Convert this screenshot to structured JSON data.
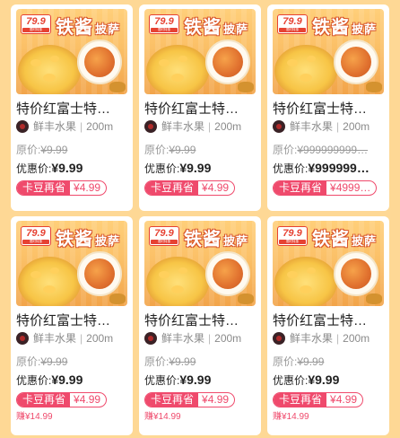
{
  "banner": {
    "price": "79.9",
    "tag_sub": "限时特惠",
    "headline_big": "铁酱",
    "headline_small": "披萨"
  },
  "row1": [
    {
      "title": "特价红富士特…",
      "shop": "鲜丰水果",
      "distance": "200m",
      "orig_label": "原价:",
      "orig_price": "¥9.99",
      "disc_label": "优惠价:",
      "disc_price": "¥9.99",
      "coupon_label": "卡豆再省",
      "coupon_amount": "¥4.99"
    },
    {
      "title": "特价红富士特…",
      "shop": "鲜丰水果",
      "distance": "200m",
      "orig_label": "原价:",
      "orig_price": "¥9.99",
      "disc_label": "优惠价:",
      "disc_price": "¥9.99",
      "coupon_label": "卡豆再省",
      "coupon_amount": "¥4.99"
    },
    {
      "title": "特价红富士特…",
      "shop": "鲜丰水果",
      "distance": "200m",
      "orig_label": "原价:",
      "orig_price": "¥999999999…",
      "disc_label": "优惠价:",
      "disc_price": "¥999999…",
      "coupon_label": "卡豆再省",
      "coupon_amount": "¥4999…"
    }
  ],
  "row2": [
    {
      "title": "特价红富士特…",
      "shop": "鲜丰水果",
      "distance": "200m",
      "orig_label": "原价:",
      "orig_price": "¥9.99",
      "disc_label": "优惠价:",
      "disc_price": "¥9.99",
      "coupon_label": "卡豆再省",
      "coupon_amount": "¥4.99",
      "earn": "赚¥14.99"
    },
    {
      "title": "特价红富士特…",
      "shop": "鲜丰水果",
      "distance": "200m",
      "orig_label": "原价:",
      "orig_price": "¥9.99",
      "disc_label": "优惠价:",
      "disc_price": "¥9.99",
      "coupon_label": "卡豆再省",
      "coupon_amount": "¥4.99",
      "earn": "赚¥14.99"
    },
    {
      "title": "特价红富士特…",
      "shop": "鲜丰水果",
      "distance": "200m",
      "orig_label": "原价:",
      "orig_price": "¥9.99",
      "disc_label": "优惠价:",
      "disc_price": "¥9.99",
      "coupon_label": "卡豆再省",
      "coupon_amount": "¥4.99",
      "earn": "赚¥14.99"
    }
  ],
  "colors": {
    "page_bg": "#fed895",
    "accent": "#ef4a6c",
    "banner_red": "#e64233"
  },
  "icons": {
    "shop_avatar": "shop-avatar-icon"
  }
}
